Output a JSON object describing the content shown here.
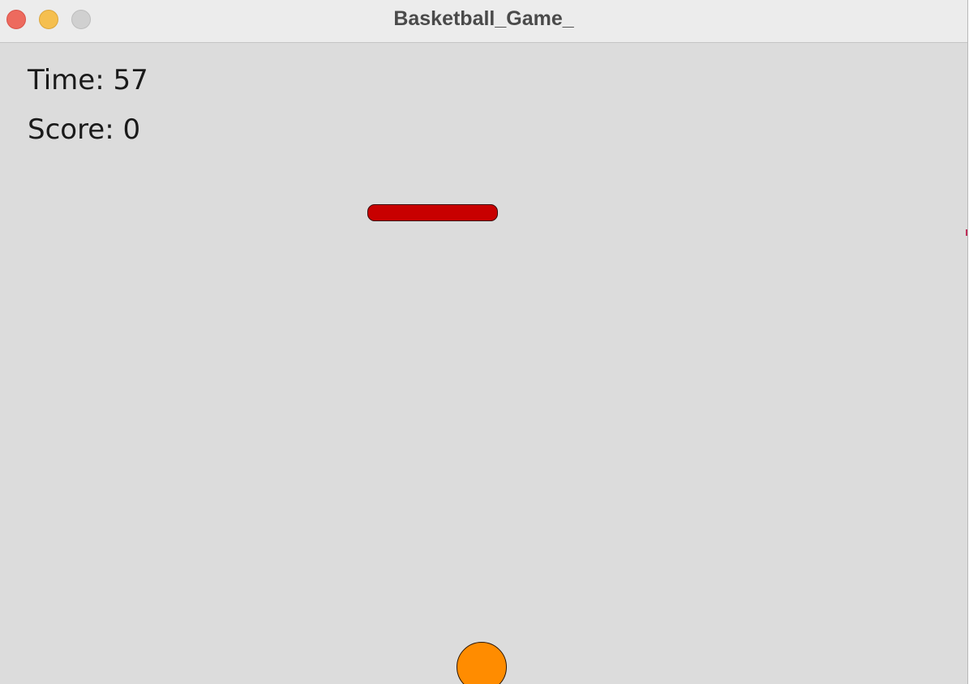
{
  "window": {
    "title": "Basketball_Game_",
    "controls": {
      "close_icon": "close-icon",
      "minimize_icon": "minimize-icon",
      "zoom_icon": "zoom-icon"
    }
  },
  "hud": {
    "time_label": "Time:",
    "time_value": "57",
    "score_label": "Score:",
    "score_value": "0"
  },
  "colors": {
    "background": "#dcdcdc",
    "paddle": "#c80000",
    "ball": "#ff8c00",
    "close": "#ed6a5e",
    "minimize": "#f5bf4f",
    "zoom": "#d0d0d0",
    "edge_mark": "#c0305a"
  }
}
